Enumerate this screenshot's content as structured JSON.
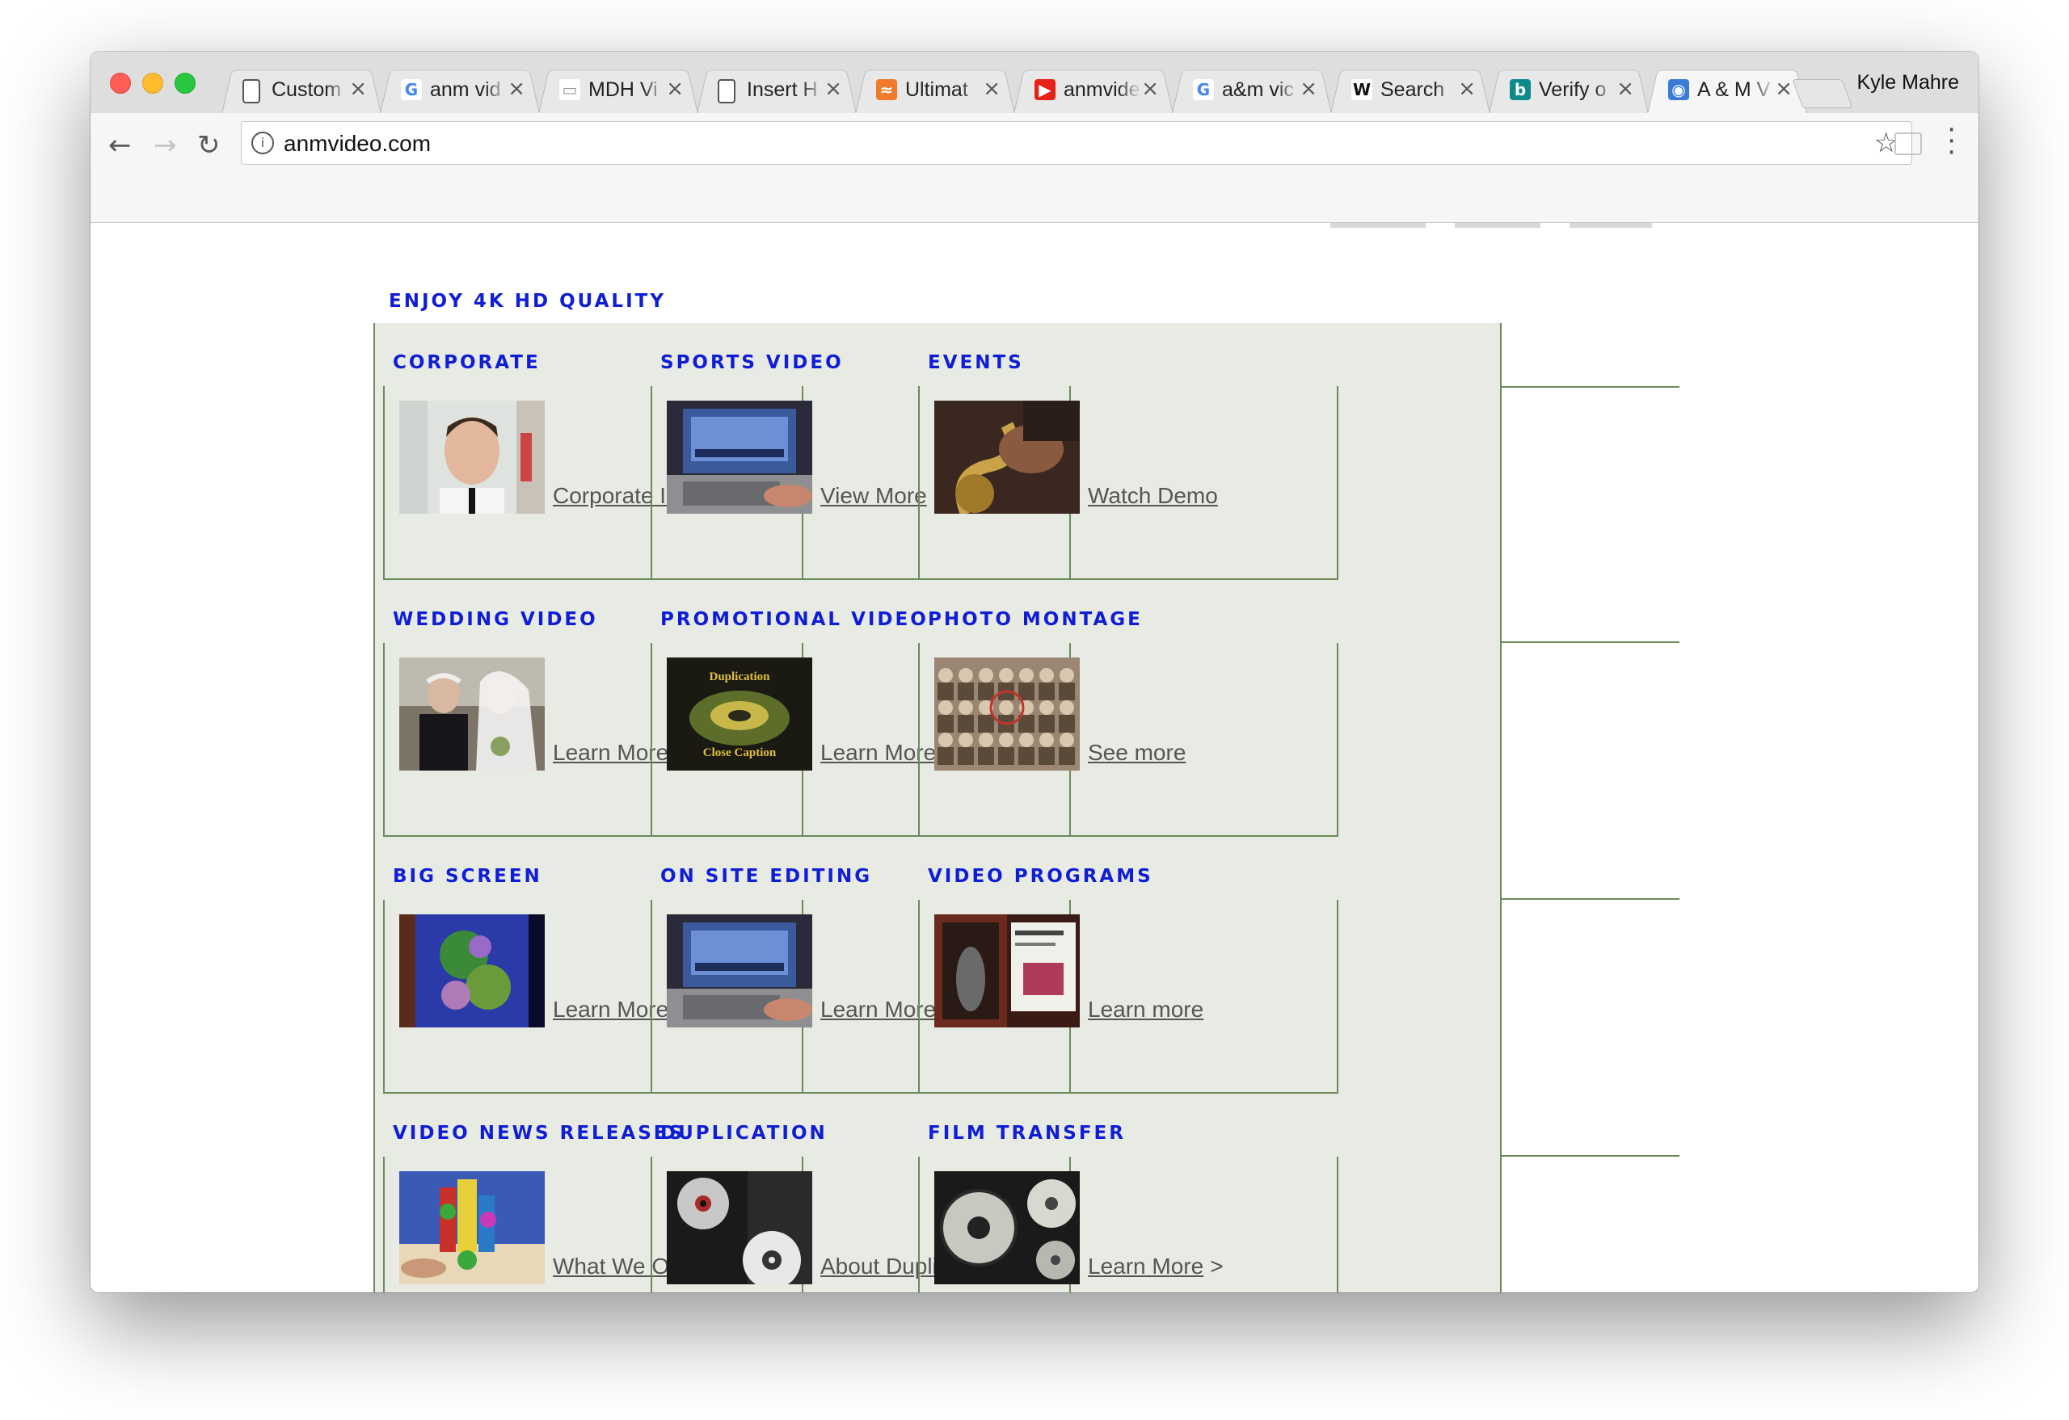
{
  "browser": {
    "tabs": [
      {
        "title": "Custom",
        "icon": "doc-icon"
      },
      {
        "title": "anm vid",
        "icon": "google-icon"
      },
      {
        "title": "MDH Vi",
        "icon": "mdh-icon"
      },
      {
        "title": "Insert H",
        "icon": "doc-icon"
      },
      {
        "title": "Ultimat",
        "icon": "orange-icon"
      },
      {
        "title": "anmvide",
        "icon": "youtube-icon"
      },
      {
        "title": "a&m vic",
        "icon": "google-icon"
      },
      {
        "title": "Search",
        "icon": "wikipedia-icon"
      },
      {
        "title": "Verify o",
        "icon": "bing-icon"
      },
      {
        "title": "A & M V",
        "icon": "globe-icon"
      }
    ],
    "profile_name": "Kyle Mahre",
    "url": "anmvideo.com"
  },
  "page": {
    "tagline": "ENJOY 4K HD QUALITY",
    "services": [
      {
        "title": "CORPORATE",
        "link": "Corporate Info",
        "thumb": "man-portrait"
      },
      {
        "title": "SPORTS VIDEO",
        "link": "View More",
        "thumb": "laptop-editing"
      },
      {
        "title": "EVENTS",
        "link": "Watch Demo",
        "thumb": "saxophone"
      },
      {
        "title": "WEDDING VIDEO",
        "link": "Learn More",
        "thumb": "wedding-couple"
      },
      {
        "title": "PROMOTIONAL VIDEO",
        "link": "Learn More",
        "thumb": "duplication-caption"
      },
      {
        "title": "PHOTO MONTAGE",
        "link": "See more",
        "thumb": "old-class-photo"
      },
      {
        "title": "BIG SCREEN",
        "link": "Learn More",
        "thumb": "big-screen"
      },
      {
        "title": "ON SITE EDITING",
        "link": "Learn More",
        "thumb": "laptop-editing"
      },
      {
        "title": "VIDEO PROGRAMS",
        "link": "Learn more",
        "thumb": "video-cases"
      },
      {
        "title": "VIDEO NEWS RELEASES",
        "link": "What We Offer",
        "thumb": "toy-figures"
      },
      {
        "title": "DUPLICATION",
        "link": "About Duplication",
        "thumb": "discs"
      },
      {
        "title": "FILM TRANSFER",
        "link": "Learn More",
        "thumb": "film-discs",
        "arrow": ">"
      }
    ]
  }
}
